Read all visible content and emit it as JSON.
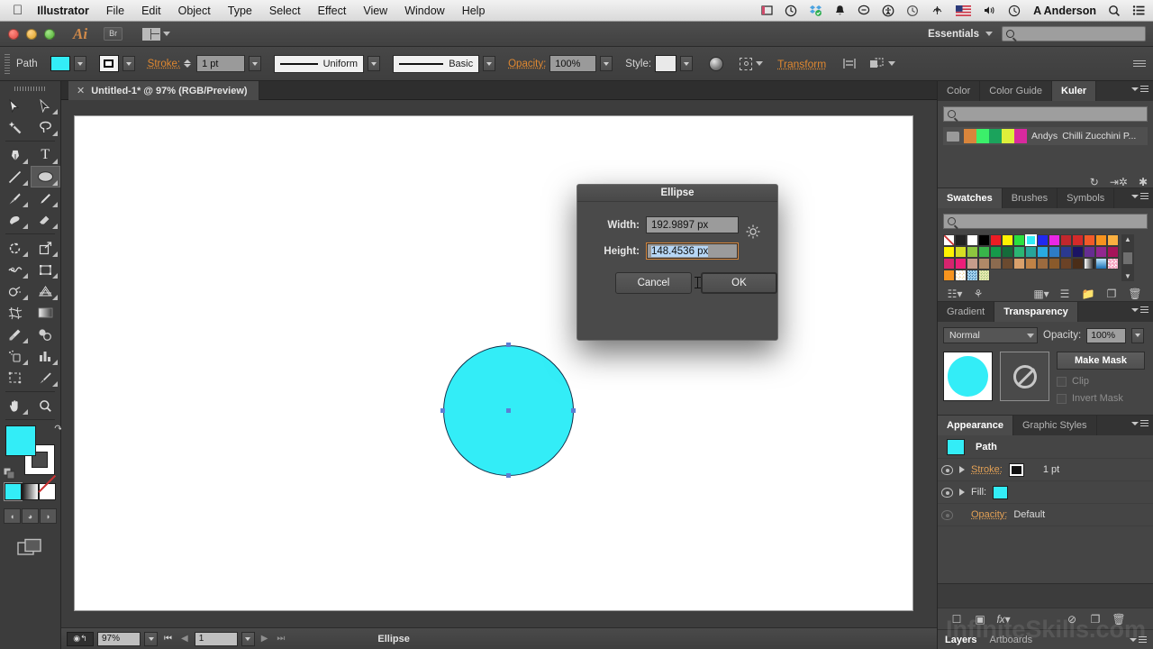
{
  "macbar": {
    "apple_icon": "apple-logo",
    "app_name": "Illustrator",
    "menus": [
      "File",
      "Edit",
      "Object",
      "Type",
      "Select",
      "Effect",
      "View",
      "Window",
      "Help"
    ],
    "status_icons": [
      "screen-record-icon",
      "timemachine-icon",
      "dropbox-icon",
      "bell-icon",
      "message-icon",
      "accessibility-icon",
      "history-icon",
      "airdrop-icon",
      "flag-icon",
      "volume-icon",
      "clock-icon"
    ],
    "user": "A Anderson",
    "search_icon": "search-icon",
    "list_icon": "notification-center-icon"
  },
  "titlebar": {
    "app_logo": "Ai",
    "bridge_button": "Br",
    "arrange_icon": "arrange-documents-icon",
    "workspace": "Essentials",
    "search_placeholder": ""
  },
  "controlbar": {
    "selection_label": "Path",
    "fill_color": "#33edf7",
    "stroke_label": "Stroke:",
    "stroke_weight": "1 pt",
    "profile": "Uniform",
    "brush": "Basic",
    "opacity_label": "Opacity:",
    "opacity_value": "100%",
    "style_label": "Style:",
    "transform_label": "Transform",
    "icons": [
      "recolor-artwork-icon",
      "align-icon",
      "isolate-icon",
      "arrange-icon"
    ]
  },
  "document": {
    "tab_title": "Untitled-1* @ 97% (RGB/Preview)",
    "close_icon": "close-icon"
  },
  "tools": {
    "grip": "panel-grip",
    "items": [
      {
        "name": "selection-tool",
        "glyph": "↖",
        "selected": false
      },
      {
        "name": "direct-selection-tool",
        "glyph": "↖",
        "selected": false
      },
      {
        "name": "magic-wand-tool",
        "glyph": "✦",
        "selected": false
      },
      {
        "name": "lasso-tool",
        "glyph": "◌",
        "selected": false
      },
      {
        "name": "pen-tool",
        "glyph": "✒",
        "selected": false
      },
      {
        "name": "type-tool",
        "glyph": "T",
        "selected": false
      },
      {
        "name": "line-segment-tool",
        "glyph": "╲",
        "selected": false
      },
      {
        "name": "ellipse-tool",
        "glyph": "⬭",
        "selected": true
      },
      {
        "name": "paintbrush-tool",
        "glyph": "✎",
        "selected": false
      },
      {
        "name": "pencil-tool",
        "glyph": "✏",
        "selected": false
      },
      {
        "name": "blob-brush-tool",
        "glyph": "◖",
        "selected": false
      },
      {
        "name": "eraser-tool",
        "glyph": "▱",
        "selected": false
      },
      {
        "name": "rotate-tool",
        "glyph": "↺",
        "selected": false
      },
      {
        "name": "scale-tool",
        "glyph": "⤡",
        "selected": false
      },
      {
        "name": "width-tool",
        "glyph": "∿",
        "selected": false
      },
      {
        "name": "free-transform-tool",
        "glyph": "◱",
        "selected": false
      },
      {
        "name": "shape-builder-tool",
        "glyph": "◔",
        "selected": false
      },
      {
        "name": "perspective-grid-tool",
        "glyph": "◧",
        "selected": false
      },
      {
        "name": "mesh-tool",
        "glyph": "⌗",
        "selected": false
      },
      {
        "name": "gradient-tool",
        "glyph": "▨",
        "selected": false
      },
      {
        "name": "eyedropper-tool",
        "glyph": "⚗",
        "selected": false
      },
      {
        "name": "blend-tool",
        "glyph": "◎",
        "selected": false
      },
      {
        "name": "symbol-sprayer-tool",
        "glyph": "⁂",
        "selected": false
      },
      {
        "name": "column-graph-tool",
        "glyph": "█",
        "selected": false
      },
      {
        "name": "artboard-tool",
        "glyph": "⧉",
        "selected": false
      },
      {
        "name": "slice-tool",
        "glyph": "✒",
        "selected": false
      },
      {
        "name": "hand-tool",
        "glyph": "✋",
        "selected": false
      },
      {
        "name": "zoom-tool",
        "glyph": "⚲",
        "selected": false
      }
    ],
    "fill_color": "#33edf7",
    "stroke_color": "#ffffff",
    "swap_icon": "swap-fill-stroke-icon",
    "default_icon": "default-fill-stroke-icon",
    "color_mode_icons": [
      "color-mode-icon",
      "gradient-mode-icon",
      "none-mode-icon"
    ],
    "screen_mode_icons": [
      "draw-normal-icon",
      "draw-behind-icon",
      "draw-inside-icon"
    ],
    "change_screen_mode_icon": "change-screen-mode-icon"
  },
  "canvas": {
    "shape_fill": "#33edf7",
    "shape_name": "ellipse-shape",
    "anchors": 5
  },
  "dialog": {
    "title": "Ellipse",
    "width_label": "Width:",
    "width_value": "192.9897 px",
    "height_label": "Height:",
    "height_value": "148.4536 px",
    "constrain_icon": "constrain-proportions-icon",
    "cancel_label": "Cancel",
    "ok_label": "OK"
  },
  "statusbar": {
    "preview_icon": "preview-toggle-icon",
    "zoom_value": "97%",
    "artboard_first_icon": "first-artboard-icon",
    "artboard_prev_icon": "prev-artboard-icon",
    "artboard_value": "1",
    "artboard_next_icon": "next-artboard-icon",
    "artboard_last_icon": "last-artboard-icon",
    "status_text": "Ellipse",
    "status_caret_icon": "status-menu-icon",
    "scroll_left_icon": "scroll-left-icon"
  },
  "panels": {
    "kuler": {
      "tabs": [
        "Color",
        "Color Guide",
        "Kuler"
      ],
      "active_tab": "Kuler",
      "menu_icon": "panel-menu-icon",
      "search_icon": "search-icon",
      "theme": {
        "folder_icon": "folder-icon",
        "author": "Andys",
        "name": "Chilli Zucchini P...",
        "swatches": [
          "#d9853b",
          "#3bf06a",
          "#1ba35c",
          "#ddef3b",
          "#d8299e"
        ]
      },
      "footer_icons": [
        "refresh-icon",
        "add-theme-icon",
        "edit-theme-icon"
      ]
    },
    "swatches": {
      "tabs": [
        "Swatches",
        "Brushes",
        "Symbols"
      ],
      "active_tab": "Swatches",
      "menu_icon": "panel-menu-icon",
      "search_icon": "search-icon",
      "selected_swatch": "#33edf7",
      "rows": [
        [
          "none",
          "registration",
          "#ffffff",
          "#000000",
          "#ed1c24",
          "#fff200",
          "#22b14c",
          "#33edf7",
          "#2029f0",
          "#e927e5",
          "#c1272d",
          "#d42a2a",
          "#f15a29",
          "#f7931e",
          "#fbb040"
        ],
        [
          "#fff200",
          "#d7df23",
          "#8dc63f",
          "#39b54a",
          "#159a4a",
          "#156b3a",
          "#2bb673",
          "#27a59a",
          "#27aae1",
          "#2e7cc6",
          "#2b3990",
          "#1b1464",
          "#662d91",
          "#92278f",
          "#a6145a"
        ],
        [
          "#d6246e",
          "#ec1e79",
          "#c69c8b",
          "#b08968",
          "#8c6b4f",
          "#6b4a2f",
          "#d9a06b",
          "#c08246",
          "#9c6b3f",
          "#8a5a2b",
          "#6b4226",
          "#4a2d18",
          "#ffffff",
          "#29abe2",
          "#f7a8c4"
        ],
        [
          "#f7941e",
          "#checker1",
          "#pattern1",
          "#pattern2"
        ]
      ],
      "footer_icons": [
        "swatch-libraries-icon",
        "show-kind-icon",
        "new-color-group-icon",
        "new-swatch-icon",
        "delete-swatch-icon"
      ]
    },
    "transparency": {
      "tabs": [
        "Gradient",
        "Transparency"
      ],
      "active_tab": "Transparency",
      "menu_icon": "panel-menu-icon",
      "blend_mode": "Normal",
      "opacity_label": "Opacity:",
      "opacity_value": "100%",
      "thumb_color": "#33edf7",
      "mask_icon": "no-mask-icon",
      "make_mask_label": "Make Mask",
      "clip_label": "Clip",
      "invert_label": "Invert Mask"
    },
    "appearance": {
      "tabs": [
        "Appearance",
        "Graphic Styles"
      ],
      "active_tab": "Appearance",
      "menu_icon": "panel-menu-icon",
      "object_chip": "#33edf7",
      "object_name": "Path",
      "rows": [
        {
          "visibility_icon": "eye-icon",
          "disclosure_icon": "disclosure-triangle-icon",
          "label": "Stroke:",
          "chip": "#000000",
          "value": "1 pt",
          "visible": true
        },
        {
          "visibility_icon": "eye-icon",
          "disclosure_icon": "disclosure-triangle-icon",
          "label": "Fill:",
          "chip": "#33edf7",
          "value": "",
          "visible": true
        },
        {
          "visibility_icon": "eye-icon",
          "disclosure_icon": "",
          "label": "Opacity:",
          "chip": "",
          "value": "Default",
          "visible": false
        }
      ],
      "footer_icons": [
        "add-new-stroke-icon",
        "add-new-fill-icon",
        "add-effect-icon",
        "clear-appearance-icon",
        "duplicate-item-icon",
        "delete-item-icon"
      ]
    },
    "layers": {
      "tabs": [
        "Layers",
        "Artboards"
      ],
      "active_tab": "Layers",
      "menu_icon": "panel-menu-icon"
    }
  },
  "watermark": {
    "text": "InfiniteSkills.com"
  }
}
